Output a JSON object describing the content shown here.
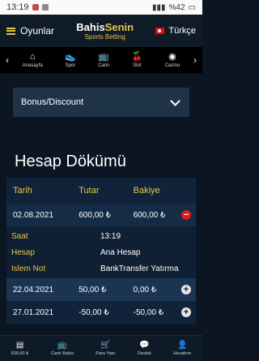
{
  "status_bar": {
    "time": "13:19",
    "battery": "%42"
  },
  "header": {
    "menu_label": "Oyunlar",
    "brand_part1": "Bahis",
    "brand_part2": "Senin",
    "brand_sub": "Sports Betting",
    "language": "Türkçe"
  },
  "categories": [
    {
      "icon": "home-icon",
      "glyph": "⌂",
      "label": "Anasayfa"
    },
    {
      "icon": "shoe-icon",
      "glyph": "👟",
      "label": "Spor"
    },
    {
      "icon": "tv-icon",
      "glyph": "📺",
      "label": "Canlı"
    },
    {
      "icon": "cherries-icon",
      "glyph": "🍒",
      "label": "Slot"
    },
    {
      "icon": "chip-icon",
      "glyph": "◉",
      "label": "Casino"
    }
  ],
  "bonus_dropdown": {
    "label": "Bonus/Discount"
  },
  "page_title": "Hesap Dökümü",
  "table": {
    "headers": [
      "Tarih",
      "Tutar",
      "Bakiye"
    ],
    "rows": [
      {
        "date": "02.08.2021",
        "amount": "600,00 ₺",
        "balance": "600,00 ₺",
        "expanded": true
      },
      {
        "date": "22.04.2021",
        "amount": "50,00 ₺",
        "balance": "0,00 ₺",
        "expanded": false
      },
      {
        "date": "27.01.2021",
        "amount": "-50,00 ₺",
        "balance": "-50,00 ₺",
        "expanded": false
      }
    ],
    "detail": {
      "time_label": "Saat",
      "time_value": "13:19",
      "account_label": "Hesap",
      "account_value": "Ana Hesap",
      "note_label": "Islem Not",
      "note_value": "BankTransfer Yatırma"
    }
  },
  "bottom_nav": [
    {
      "icon": "balance-icon",
      "glyph": "▤",
      "label": "600,00 ₺"
    },
    {
      "icon": "live-bet-icon",
      "glyph": "📺",
      "label": "Canlı Bahis"
    },
    {
      "icon": "cart-icon",
      "glyph": "🛒",
      "label": "Para Yatır"
    },
    {
      "icon": "chat-icon",
      "glyph": "💬",
      "label": "Destek"
    },
    {
      "icon": "user-icon",
      "glyph": "👤",
      "label": "Hesabım"
    }
  ],
  "colors": {
    "accent": "#e8c34a",
    "background": "#0b1622",
    "panel": "#1e3248",
    "danger": "#e01b1b"
  }
}
